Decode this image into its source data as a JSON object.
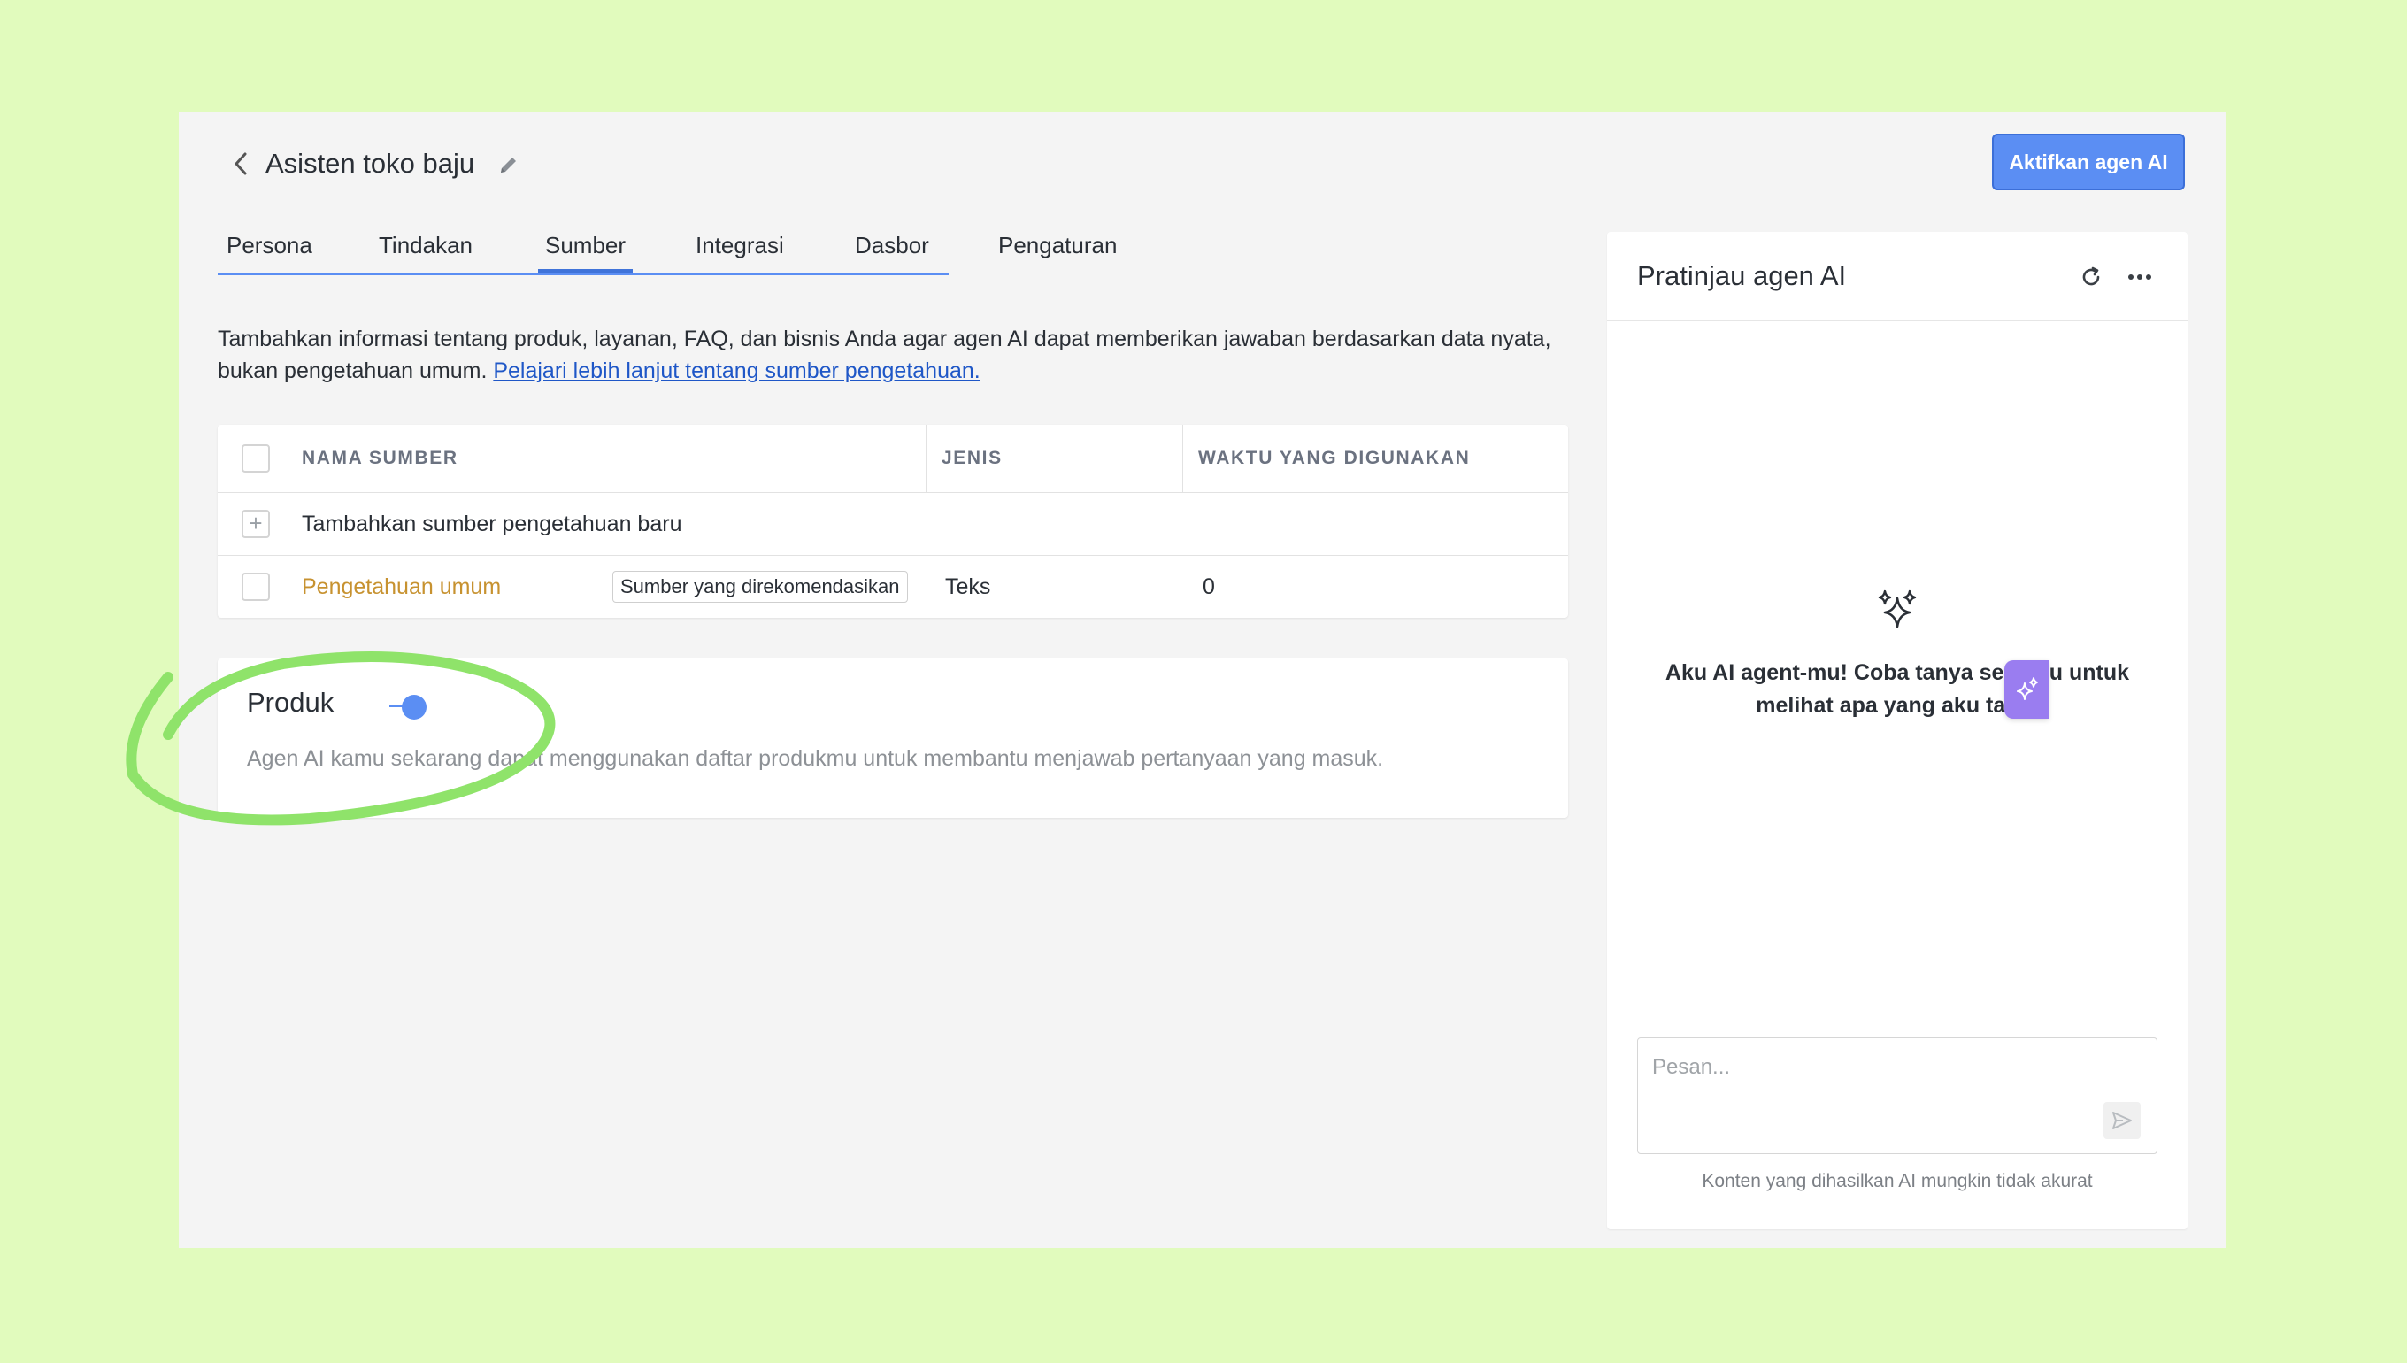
{
  "header": {
    "title": "Asisten toko baju",
    "activate_label": "Aktifkan agen AI"
  },
  "tabs": [
    {
      "label": "Persona"
    },
    {
      "label": "Tindakan"
    },
    {
      "label": "Sumber",
      "active": true
    },
    {
      "label": "Integrasi"
    },
    {
      "label": "Dasbor"
    },
    {
      "label": "Pengaturan"
    }
  ],
  "description": {
    "text": "Tambahkan informasi tentang produk, layanan, FAQ, dan bisnis Anda agar agen AI dapat memberikan jawaban berdasarkan data nyata, bukan pengetahuan umum. ",
    "link": "Pelajari lebih lanjut tentang sumber pengetahuan."
  },
  "table": {
    "columns": [
      "NAMA SUMBER",
      "JENIS",
      "WAKTU YANG DIGUNAKAN"
    ],
    "add_row_label": "Tambahkan sumber pengetahuan baru",
    "rows": [
      {
        "name": "Pengetahuan umum",
        "badge": "Sumber yang direkomendasikan",
        "type": "Teks",
        "times_used": "0"
      }
    ]
  },
  "product_card": {
    "title": "Produk",
    "enabled": true,
    "description": "Agen AI kamu sekarang dapat menggunakan daftar produkmu untuk membantu menjawab pertanyaan yang masuk."
  },
  "preview": {
    "title": "Pratinjau agen AI",
    "empty_message": "Aku AI agent-mu! Coba tanya sesuatu untuk melihat apa yang aku tahu.",
    "input_placeholder": "Pesan...",
    "disclaimer": "Konten yang dihasilkan AI mungkin tidak akurat"
  },
  "colors": {
    "background": "#e1fbbd",
    "accent": "#5b8ef3",
    "source_name": "#c79230",
    "annotation": "#8fe36a",
    "fab": "#9a7df0"
  }
}
